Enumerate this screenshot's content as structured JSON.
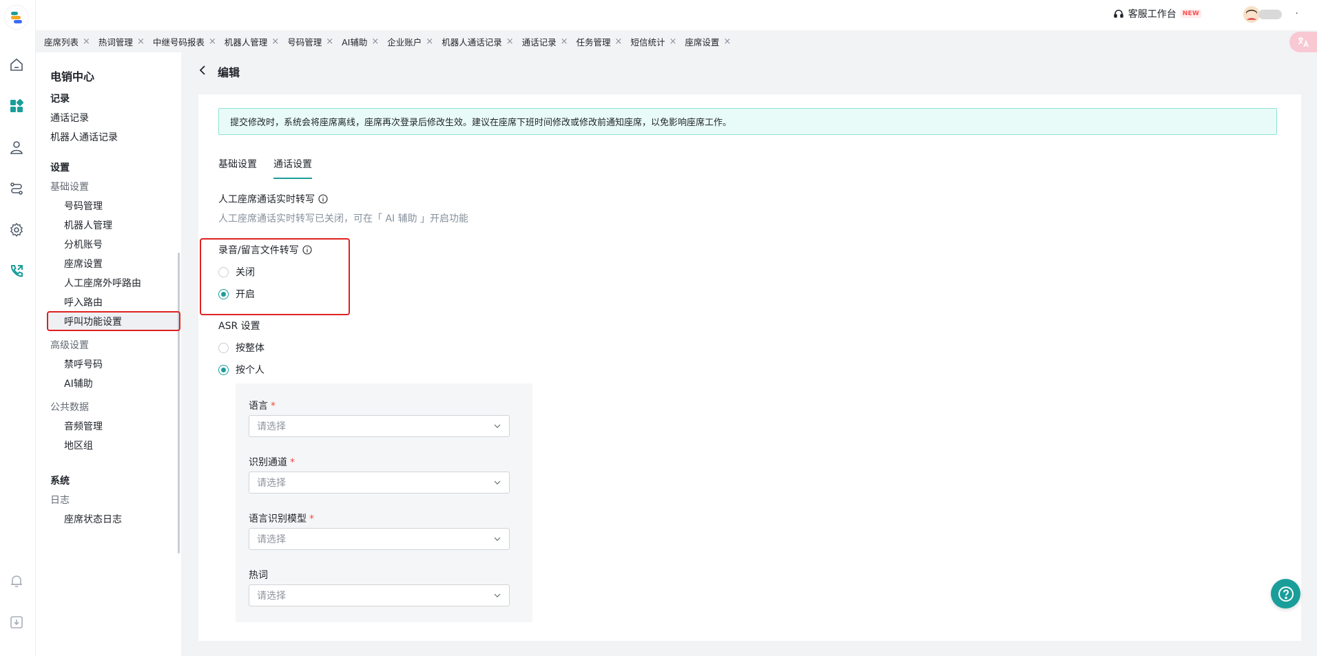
{
  "rail": {
    "icons": [
      "home-icon",
      "apps-icon",
      "customer-icon",
      "routing-icon",
      "settings-icon",
      "phone-icon",
      "bell-icon",
      "download-icon"
    ]
  },
  "topbar": {
    "workbench_label": "客服工作台",
    "new_badge": "NEW",
    "more": "·"
  },
  "tabs": [
    {
      "label": "座席列表"
    },
    {
      "label": "热词管理"
    },
    {
      "label": "中继号码报表"
    },
    {
      "label": "机器人管理"
    },
    {
      "label": "号码管理"
    },
    {
      "label": "AI辅助"
    },
    {
      "label": "企业账户"
    },
    {
      "label": "机器人通话记录"
    },
    {
      "label": "通话记录"
    },
    {
      "label": "任务管理"
    },
    {
      "label": "短信统计"
    },
    {
      "label": "座席设置"
    }
  ],
  "sidebar": {
    "title": "电销中心",
    "group_records": "记录",
    "records_items": [
      "通话记录",
      "机器人通话记录"
    ],
    "group_settings": "设置",
    "sub_basic": "基础设置",
    "basic_items": [
      "号码管理",
      "机器人管理",
      "分机账号",
      "座席设置",
      "人工座席外呼路由",
      "呼入路由",
      "呼叫功能设置"
    ],
    "sub_advanced": "高级设置",
    "advanced_items": [
      "禁呼号码",
      "AI辅助"
    ],
    "sub_public": "公共数据",
    "public_items": [
      "音频管理",
      "地区组"
    ],
    "group_system": "系统",
    "sub_logs": "日志",
    "logs_items": [
      "座席状态日志"
    ],
    "active_item": "座席设置"
  },
  "content": {
    "back_title": "编辑",
    "notice": "提交修改时，系统会将座席离线，座席再次登录后修改生效。建议在座席下班时间修改或修改前通知座席，以免影响座席工作。",
    "tabs": [
      "基础设置",
      "通话设置"
    ],
    "active_tab": "通话设置",
    "realtime_label": "人工座席通话实时转写",
    "realtime_hint": "人工座席通话实时转写已关闭，可在「 AI 辅助 」开启功能",
    "file_transcribe_label": "录音/留言文件转写",
    "file_transcribe_options": [
      "关闭",
      "开启"
    ],
    "file_transcribe_selected": "开启",
    "asr_label": "ASR 设置",
    "asr_options": [
      "按整体",
      "按个人"
    ],
    "asr_selected": "按个人",
    "fields": [
      {
        "label": "语言",
        "required": true,
        "placeholder": "请选择"
      },
      {
        "label": "识别通道",
        "required": true,
        "placeholder": "请选择"
      },
      {
        "label": "语言识别模型",
        "required": true,
        "placeholder": "请选择"
      },
      {
        "label": "热词",
        "required": false,
        "placeholder": "请选择"
      }
    ],
    "required_mark": "*"
  },
  "colors": {
    "accent": "#1a9e9a",
    "highlight": "#e02020",
    "notice_bg": "#e9fbf8"
  }
}
